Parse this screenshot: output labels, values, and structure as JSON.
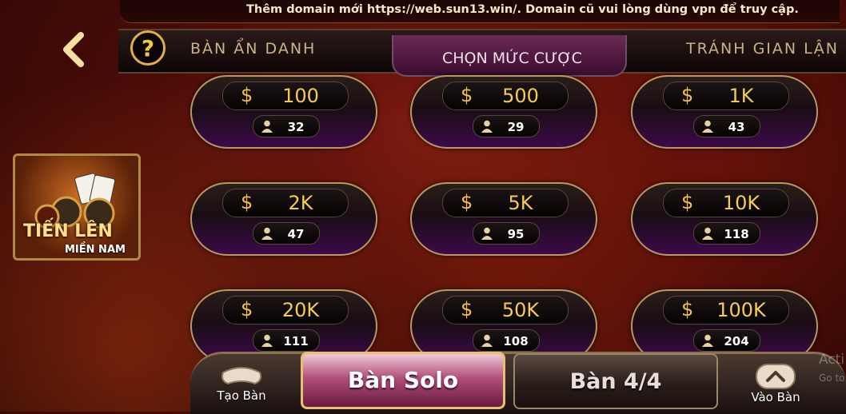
{
  "notice": "Thêm domain mới https://web.sun13.win/. Domain cũ vui lòng dùng vpn để truy cập.",
  "tabs": {
    "help_symbol": "?",
    "left": "BÀN ẨN DANH",
    "center": "CHỌN MỨC CƯỢC",
    "right": "TRÁNH GIAN LẬN"
  },
  "game_logo": {
    "title": "TIẾN LÊN",
    "subtitle": "MIỀN NAM"
  },
  "currency_symbol": "$",
  "bets": [
    {
      "amount": "100",
      "players": "32"
    },
    {
      "amount": "500",
      "players": "29"
    },
    {
      "amount": "1K",
      "players": "43"
    },
    {
      "amount": "2K",
      "players": "47"
    },
    {
      "amount": "5K",
      "players": "95"
    },
    {
      "amount": "10K",
      "players": "118"
    },
    {
      "amount": "20K",
      "players": "111"
    },
    {
      "amount": "50K",
      "players": "108"
    },
    {
      "amount": "100K",
      "players": "204"
    }
  ],
  "bottom": {
    "create_table": "Tạo Bàn",
    "solo": "Bàn Solo",
    "four": "Bàn 4/4",
    "join_table": "Vào Bàn"
  },
  "watermark": {
    "line1": "Acti",
    "line2": "Go to"
  },
  "colors": {
    "gold": "#f5cc50",
    "accent_purple": "#3c0a4a",
    "background": "#4a0c08"
  }
}
